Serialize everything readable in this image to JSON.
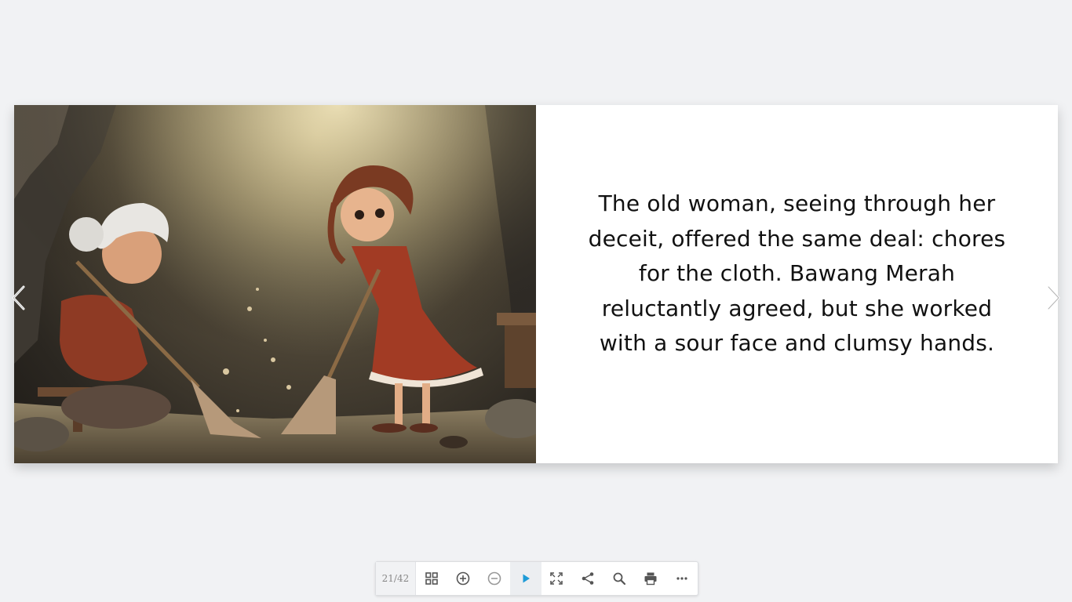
{
  "book": {
    "illustration": "old-woman-and-girl-sweeping-illustration",
    "text": "The old woman, seeing through her deceit, offered the same deal: chores for the cloth. Bawang Merah reluctantly agreed, but she worked with a sour face and clumsy hands."
  },
  "navigation": {
    "prev_icon": "chevron-left-icon",
    "next_icon": "chevron-right-icon"
  },
  "toolbar": {
    "page_counter": "21/42",
    "buttons": [
      {
        "icon": "grid-icon"
      },
      {
        "icon": "zoom-in-icon"
      },
      {
        "icon": "zoom-out-icon"
      },
      {
        "icon": "play-icon"
      },
      {
        "icon": "fullscreen-icon"
      },
      {
        "icon": "share-icon"
      },
      {
        "icon": "search-icon"
      },
      {
        "icon": "print-icon"
      },
      {
        "icon": "more-icon"
      }
    ]
  },
  "colors": {
    "background": "#f1f2f4",
    "accent_play": "#1e9bd7",
    "icon": "#555555"
  }
}
